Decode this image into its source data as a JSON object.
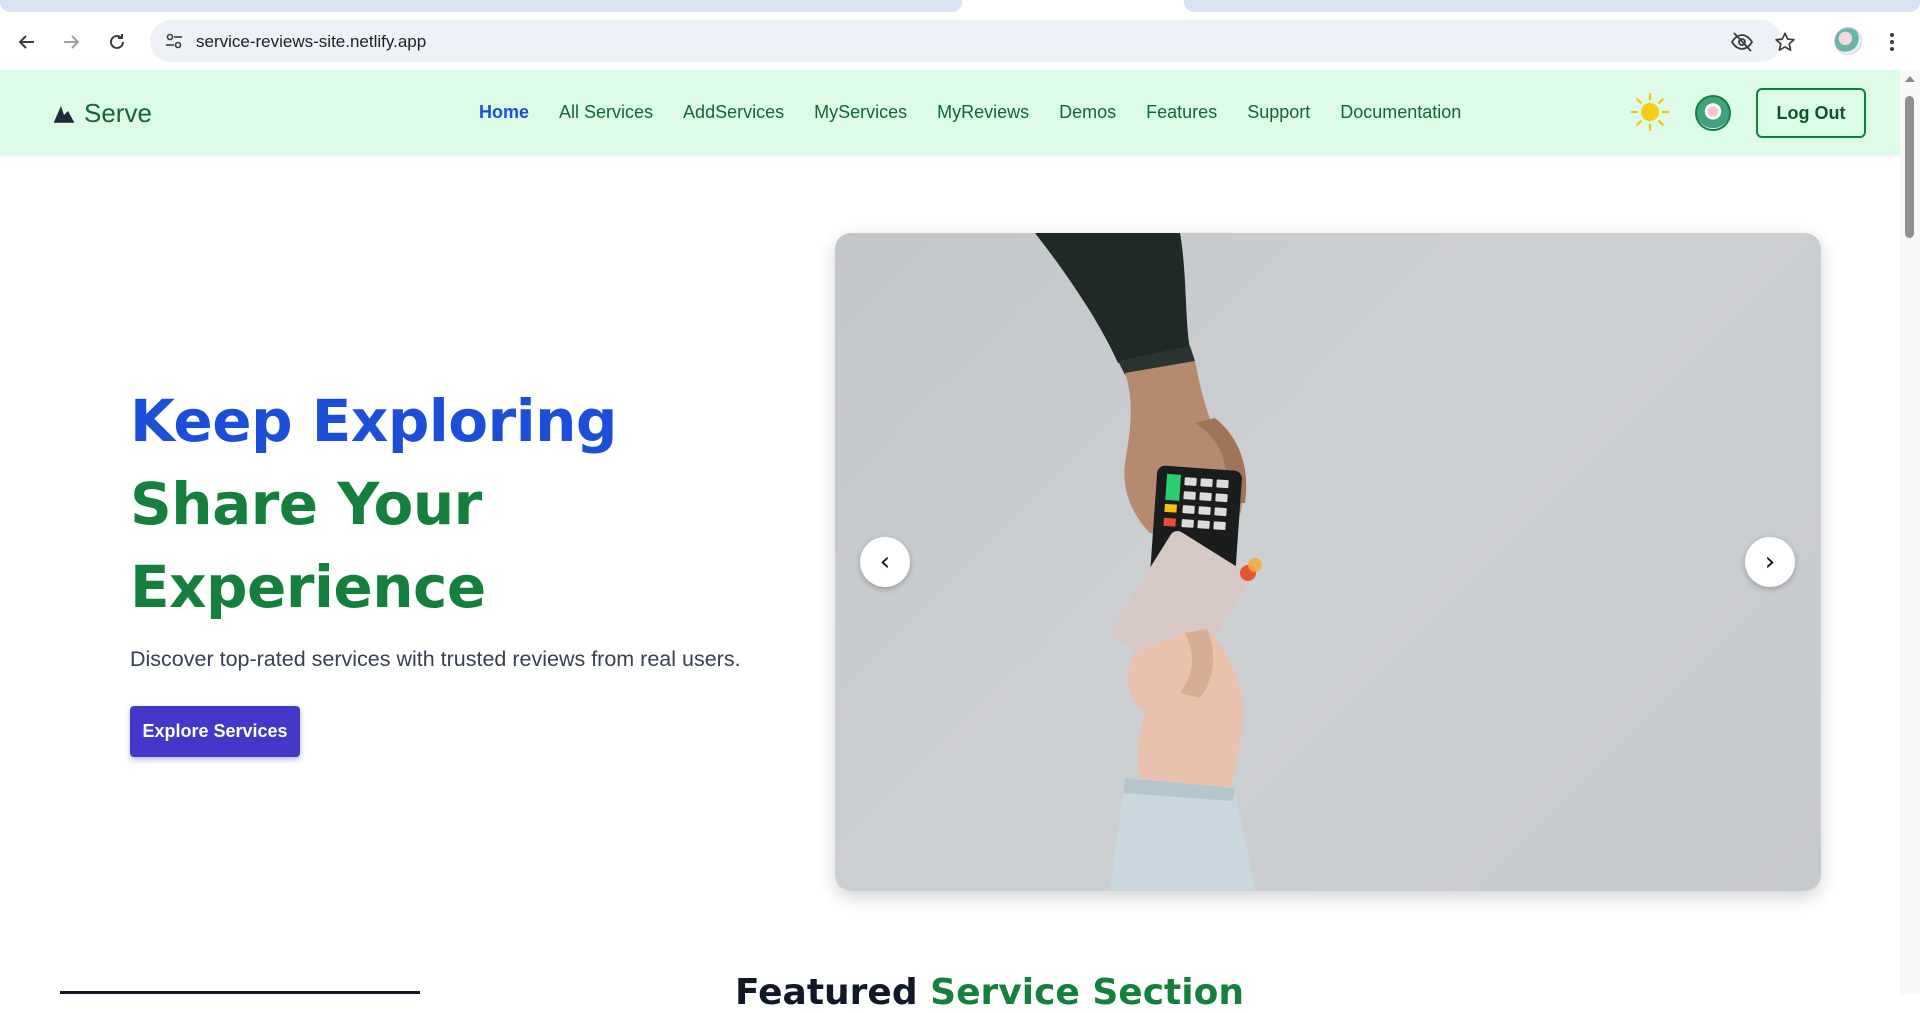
{
  "browser": {
    "url": "service-reviews-site.netlify.app",
    "icons": {
      "back": "arrow-left-icon",
      "forward": "arrow-right-icon",
      "reload": "reload-icon",
      "site_info": "tune-icon",
      "tracking": "eye-off-icon",
      "bookmark": "star-icon",
      "menu": "kebab-menu-icon"
    }
  },
  "nav": {
    "brand": "Serve",
    "links": [
      "Home",
      "All Services",
      "AddServices",
      "MyServices",
      "MyReviews",
      "Demos",
      "Features",
      "Support",
      "Documentation"
    ],
    "active": "Home",
    "logout_label": "Log Out",
    "theme_icon": "sun-icon"
  },
  "hero": {
    "line1": "Keep Exploring",
    "line2": "Share Your",
    "line3": "Experience",
    "subtitle": "Discover top-rated services with trusted reviews from real users.",
    "cta_label": "Explore Services",
    "carousel": {
      "prev": "‹",
      "next": "›"
    }
  },
  "featured": {
    "dark": "Featured",
    "green": "Service Section"
  },
  "colors": {
    "nav_bg": "#dcfce7",
    "brand_green": "#15803d",
    "active_blue": "#1d4ed8",
    "cta_indigo": "#4338ca"
  }
}
